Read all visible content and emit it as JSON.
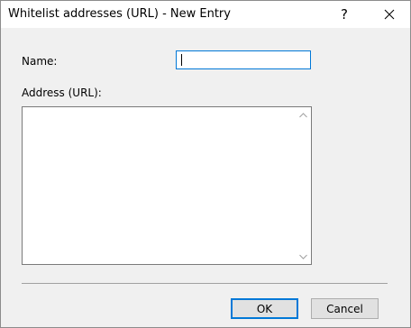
{
  "window": {
    "title": "Whitelist addresses (URL) - New Entry",
    "help_glyph": "?",
    "close_glyph": "close-icon"
  },
  "form": {
    "name_label": "Name:",
    "name_value": "",
    "address_label": "Address (URL):",
    "address_value": ""
  },
  "buttons": {
    "ok_label": "OK",
    "cancel_label": "Cancel"
  },
  "colors": {
    "focus_accent": "#0078d7",
    "dialog_background": "#f0f0f0"
  }
}
